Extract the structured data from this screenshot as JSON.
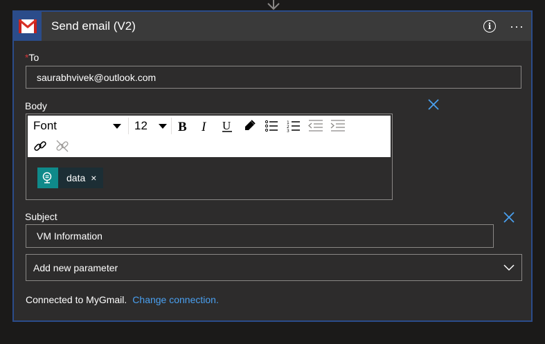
{
  "card": {
    "title": "Send email (V2)",
    "more_label": "···"
  },
  "to": {
    "label": "To",
    "required_marker": "*",
    "value": "saurabhvivek@outlook.com"
  },
  "body": {
    "label": "Body",
    "toolbar": {
      "font_label": "Font",
      "size_value": "12"
    },
    "token_label": "data",
    "token_close": "×"
  },
  "subject": {
    "label": "Subject",
    "value": "VM Information"
  },
  "add_parameter": {
    "label": "Add new parameter"
  },
  "connection": {
    "text": "Connected to MyGmail.",
    "link": "Change connection."
  },
  "colors": {
    "accent_blue": "#2b4c8a",
    "link_blue": "#4aa0f0",
    "required_red": "#d13438",
    "token_teal": "#0f8a8a"
  }
}
